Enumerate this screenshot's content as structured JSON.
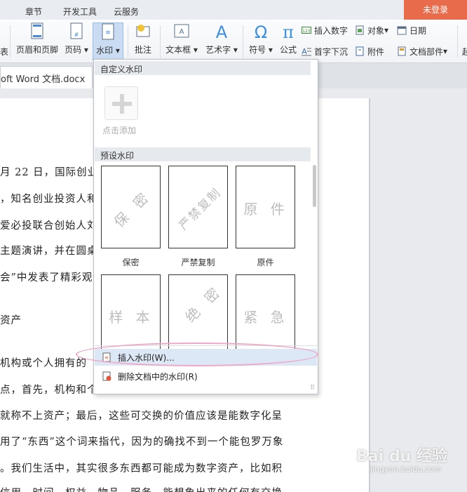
{
  "top_tabs": [
    "章节",
    "开发工具",
    "云服务"
  ],
  "login_label": "未登录",
  "ribbon": {
    "left_fragment": "表",
    "header_footer": "页眉和页脚",
    "page_number": "页码",
    "watermark": "水印",
    "comment": "批注",
    "textbox": "文本框",
    "wordart": "艺术字",
    "symbol": "符号",
    "formula": "公式",
    "insert_number": "插入数字",
    "object": "对象",
    "date": "日期",
    "dropcap": "首字下沉",
    "attachment": "附件",
    "doc_parts": "文档部件",
    "right_fragment": "起"
  },
  "doc_tab": {
    "title": "oft Word 文档.docx",
    "arrow": "›"
  },
  "document_lines": [
    "月 22 日，国际创业",
    "，知名创业投资人和",
    "爱必投联合创始人刘",
    "主题演讲，并在圆桌",
    "会”中发表了精彩观",
    "资产",
    "机构或个人拥有的",
    "点，首先，机构和个",
    "就称不上资产；最后，这些可交换的价值应该是能数字化呈",
    "用了“东西”这个词来指代，因为的确找不到一个能包罗万象",
    "。我们生活中，其实很多东西都可能成为数字资产，比如积",
    "信用、时间、权益、物品、服务，能想象出来的任何有交换"
  ],
  "panel": {
    "custom_header": "自定义水印",
    "add_label": "点击添加",
    "preset_header": "预设水印",
    "presets": [
      {
        "text": "保 密",
        "label": "保密"
      },
      {
        "text": "严禁复制",
        "label": "严禁复制"
      },
      {
        "text": "原 件",
        "label": "原件"
      },
      {
        "text": "样 本",
        "label": ""
      },
      {
        "text": "绝 密",
        "label": ""
      },
      {
        "text": "紧 急",
        "label": ""
      }
    ],
    "insert_item": "插入水印(W)...",
    "delete_item": "删除文档中的水印(R)"
  },
  "site_watermark": {
    "brand": "Bai du 经验",
    "url": "jingyan.baidu.com"
  }
}
